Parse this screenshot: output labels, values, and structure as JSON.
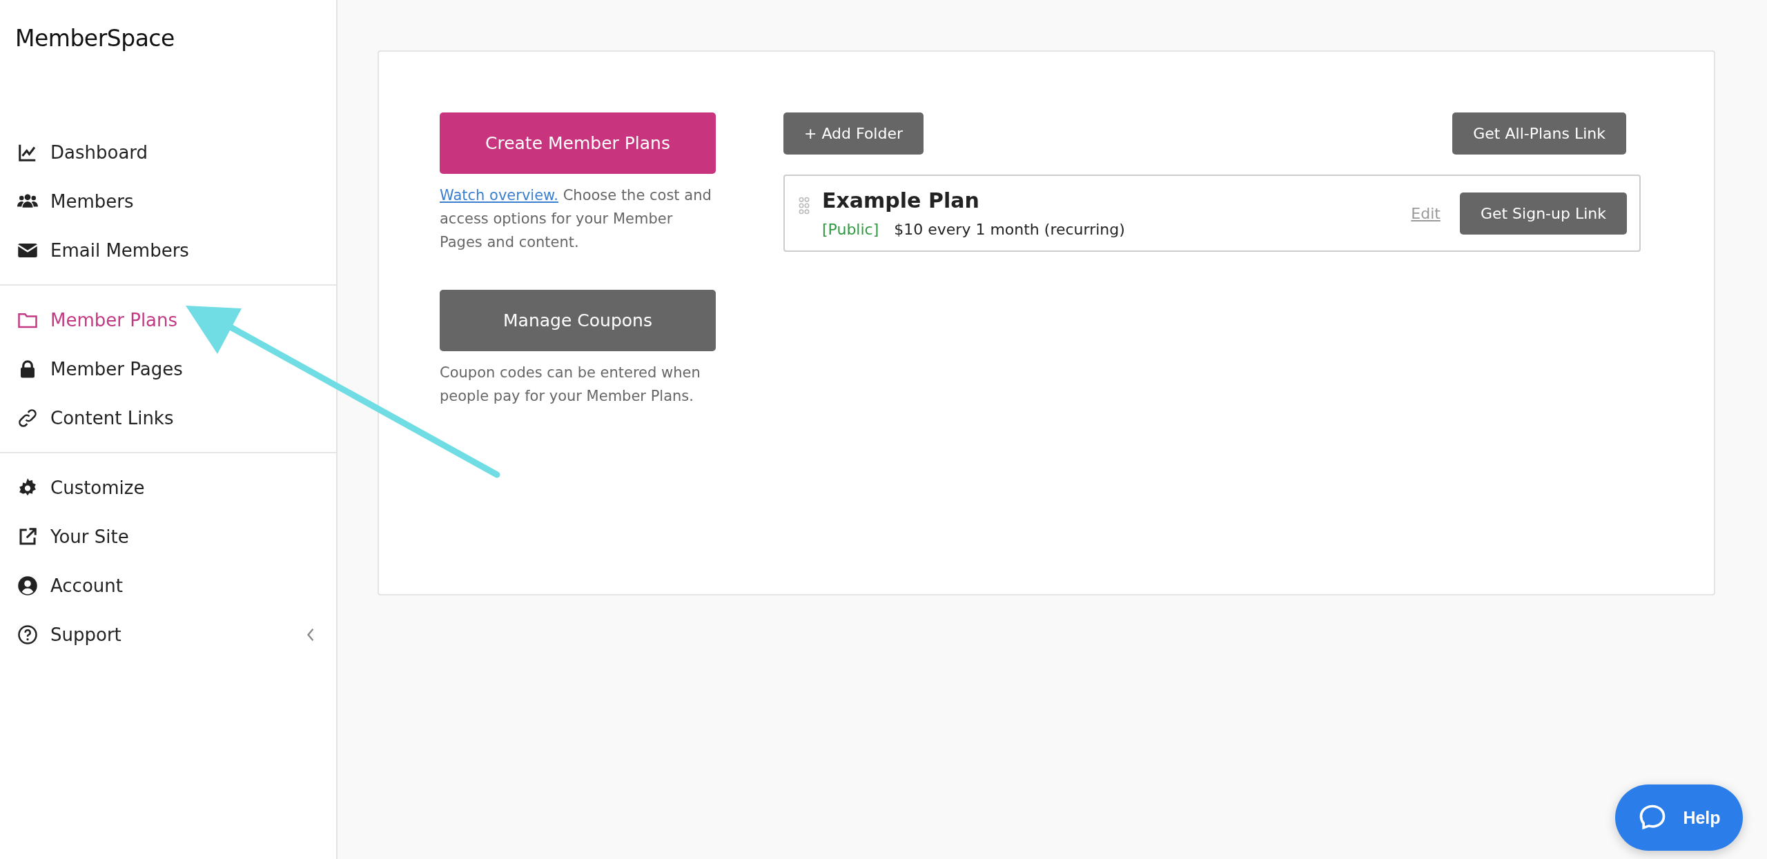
{
  "brand": {
    "logo": "MemberSpace"
  },
  "sidebar": {
    "groups": [
      [
        {
          "label": "Dashboard",
          "selected": false
        },
        {
          "label": "Members",
          "selected": false
        },
        {
          "label": "Email Members",
          "selected": false
        }
      ],
      [
        {
          "label": "Member Plans",
          "selected": true
        },
        {
          "label": "Member Pages",
          "selected": false
        },
        {
          "label": "Content Links",
          "selected": false
        }
      ],
      [
        {
          "label": "Customize",
          "selected": false
        },
        {
          "label": "Your Site",
          "selected": false
        },
        {
          "label": "Account",
          "selected": false
        },
        {
          "label": "Support",
          "selected": false
        }
      ]
    ]
  },
  "actions": [
    {
      "kind": "primary",
      "label": "Create Member Plans",
      "link": "Watch overview.",
      "description": " Choose the cost and access options for your Member Pages and content."
    },
    {
      "kind": "secondary",
      "label": "Manage Coupons",
      "description": "Coupon codes can be entered when people pay for your Member Plans."
    }
  ],
  "toolbar": {
    "add_folder": "+ Add Folder",
    "all_plans_link": "Get All-Plans Link"
  },
  "plans": [
    {
      "name": "Example Plan",
      "visibility": "[Public]",
      "price": "$10 every 1 month (recurring)",
      "edit": "Edit",
      "signup_link": "Get Sign-up Link"
    }
  ],
  "help_button": {
    "label": "Help"
  }
}
